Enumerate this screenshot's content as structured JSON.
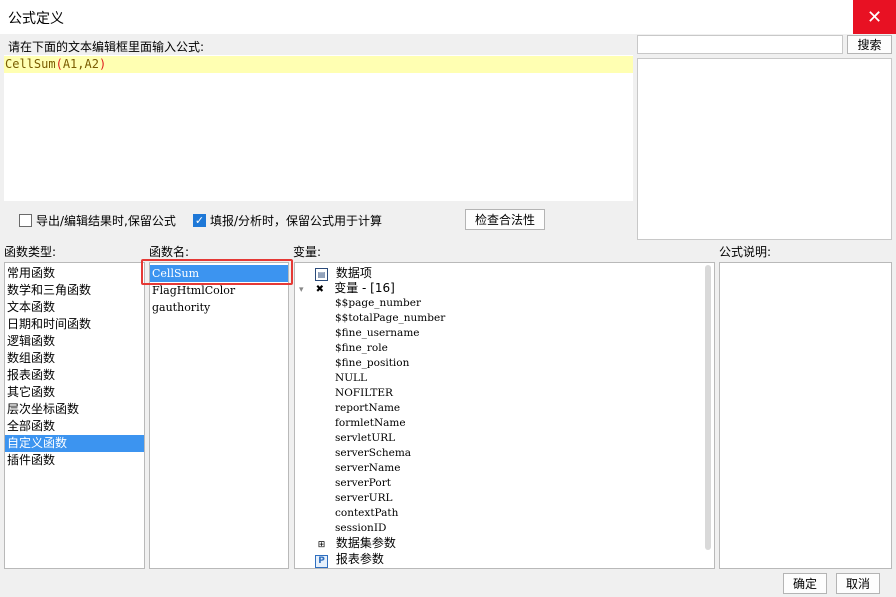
{
  "window": {
    "title": "公式定义",
    "close_glyph": "✕"
  },
  "editor": {
    "prompt": "请在下面的文本编辑框里面输入公式:",
    "formula_fn": "CellSum",
    "formula_open": "(",
    "formula_args": "A1,A2",
    "formula_close": ")"
  },
  "search": {
    "value": "",
    "button": "搜索"
  },
  "options": {
    "export_keep": {
      "label": "导出/编辑结果时,保留公式",
      "checked": false
    },
    "fill_keep": {
      "label": "填报/分析时，保留公式用于计算",
      "checked": true
    },
    "check_button": "检查合法性"
  },
  "headers": {
    "categories": "函数类型:",
    "functions": "函数名:",
    "variables": "变量:",
    "description": "公式说明:"
  },
  "categories": [
    "常用函数",
    "数学和三角函数",
    "文本函数",
    "日期和时间函数",
    "逻辑函数",
    "数组函数",
    "报表函数",
    "其它函数",
    "层次坐标函数",
    "全部函数",
    "自定义函数",
    "插件函数"
  ],
  "selected_category": "自定义函数",
  "functions": [
    "CellSum",
    "FlagHtmlColor",
    "gauthority"
  ],
  "selected_function": "CellSum",
  "variables": {
    "data_items": "数据项",
    "var_group": "变量 - [16]",
    "var_items": [
      "$$page_number",
      "$$totalPage_number",
      "$fine_username",
      "$fine_role",
      "$fine_position",
      "NULL",
      "NOFILTER",
      "reportName",
      "formletName",
      "servletURL",
      "serverSchema",
      "serverName",
      "serverPort",
      "serverURL",
      "contextPath",
      "sessionID"
    ],
    "dataset_params": "数据集参数",
    "report_params": "报表参数"
  },
  "buttons": {
    "ok": "确定",
    "cancel": "取消"
  },
  "colors": {
    "accent": "#3c94f0",
    "close": "#e81123",
    "formula_bg": "#ffffb2",
    "highlight_border": "#e53935"
  }
}
